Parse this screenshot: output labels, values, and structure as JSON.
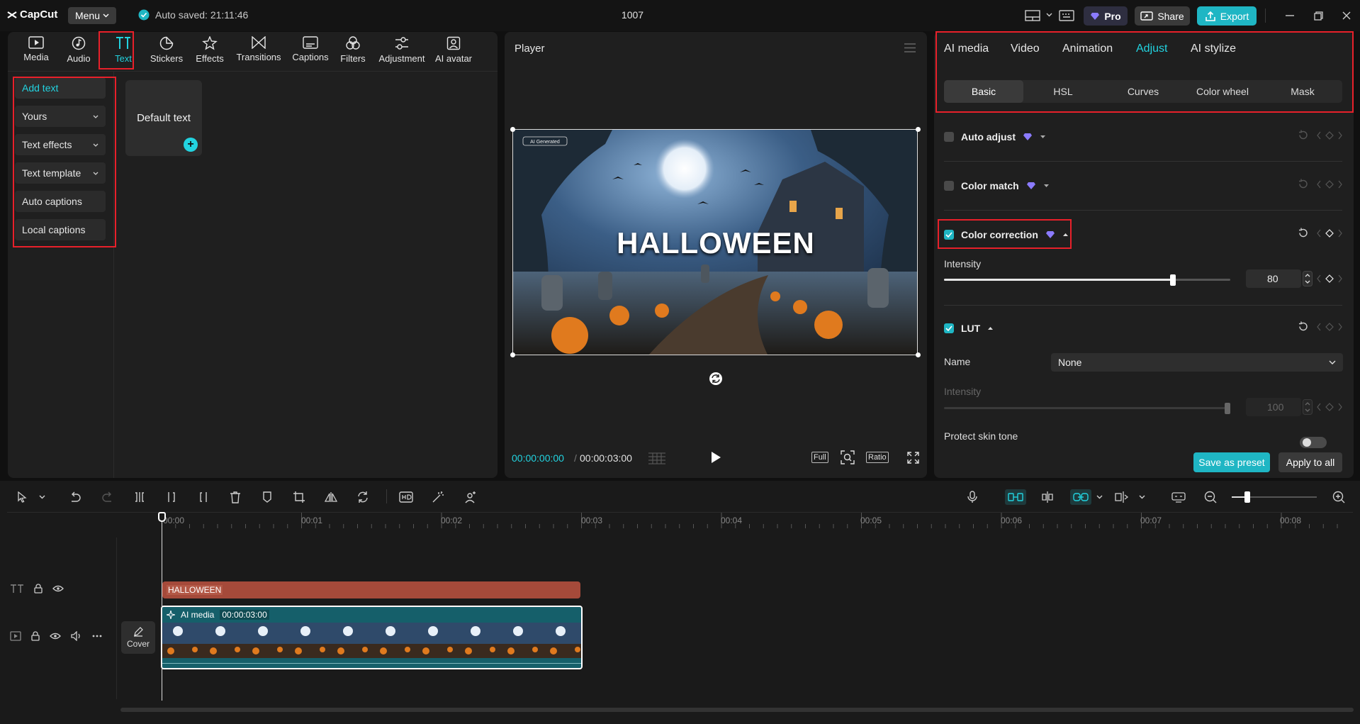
{
  "app": {
    "logo": "CapCut",
    "menu_label": "Menu",
    "autosave": "Auto saved: 21:11:46",
    "project_title": "1007",
    "pro_label": "Pro",
    "share_label": "Share",
    "export_label": "Export"
  },
  "toolbar": {
    "items": [
      {
        "label": "Media",
        "icon": "media-icon"
      },
      {
        "label": "Audio",
        "icon": "audio-icon"
      },
      {
        "label": "Text",
        "icon": "text-icon"
      },
      {
        "label": "Stickers",
        "icon": "stickers-icon"
      },
      {
        "label": "Effects",
        "icon": "effects-icon"
      },
      {
        "label": "Transitions",
        "icon": "transitions-icon"
      },
      {
        "label": "Captions",
        "icon": "captions-icon"
      },
      {
        "label": "Filters",
        "icon": "filters-icon"
      },
      {
        "label": "Adjustment",
        "icon": "adjustment-icon"
      },
      {
        "label": "AI avatar",
        "icon": "ai-avatar-icon"
      }
    ],
    "active": "Text"
  },
  "text_sidebar": {
    "items": [
      {
        "label": "Add text",
        "expandable": false
      },
      {
        "label": "Yours",
        "expandable": true
      },
      {
        "label": "Text effects",
        "expandable": true
      },
      {
        "label": "Text template",
        "expandable": true
      },
      {
        "label": "Auto captions",
        "expandable": false
      },
      {
        "label": "Local captions",
        "expandable": false
      }
    ],
    "default_card": "Default text"
  },
  "player": {
    "title": "Player",
    "overlay_text": "HALLOWEEN",
    "watermark": "AI Generated",
    "current_time": "00:00:00:00",
    "total_time": "00:00:03:00",
    "full_label": "Full",
    "ratio_label": "Ratio"
  },
  "inspector": {
    "tabs": [
      "AI media",
      "Video",
      "Animation",
      "Adjust",
      "AI stylize"
    ],
    "active_tab": "Adjust",
    "subtabs": [
      "Basic",
      "HSL",
      "Curves",
      "Color wheel",
      "Mask"
    ],
    "active_subtab": "Basic",
    "auto_adjust": "Auto adjust",
    "color_match": "Color match",
    "color_correction": "Color correction",
    "intensity_label": "Intensity",
    "intensity_value": "80",
    "intensity_fraction": 0.8,
    "lut_label": "LUT",
    "lut_name_label": "Name",
    "lut_name_value": "None",
    "lut_intensity_label": "Intensity",
    "lut_intensity_value": "100",
    "protect_skin": "Protect skin tone",
    "save_preset": "Save as preset",
    "apply_all": "Apply to all"
  },
  "timeline": {
    "ticks": [
      "00:00",
      "00:01",
      "00:02",
      "00:03",
      "00:04",
      "00:05",
      "00:06",
      "00:07",
      "00:08"
    ],
    "text_clip_label": "HALLOWEEN",
    "media_clip_label": "AI media",
    "media_clip_duration": "00:00:03:00",
    "cover_label": "Cover"
  },
  "colors": {
    "accent": "#22d3e0",
    "highlight_box": "#e8202a",
    "text_clip": "#a54a3a",
    "media_clip": "#155f6a"
  }
}
